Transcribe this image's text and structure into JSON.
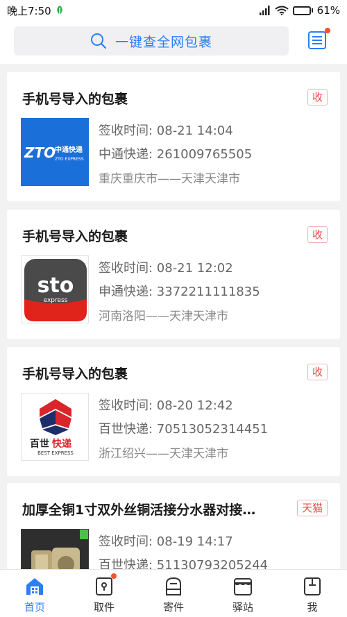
{
  "status_bar": {
    "time": "晚上7:50",
    "battery": "61%",
    "battery_level": 0.61
  },
  "search": {
    "placeholder": "一键查全网包裹"
  },
  "packages": [
    {
      "title": "手机号导入的包裹",
      "tag": "收",
      "signed": "签收时间: 08-21 14:04",
      "courier": "中通快递: 261009765505",
      "route": "重庆重庆市——天津天津市",
      "logo": {
        "brand": "ZTO",
        "cn": "中通快递",
        "en": "ZTO EXPRESS"
      }
    },
    {
      "title": "手机号导入的包裹",
      "tag": "收",
      "signed": "签收时间: 08-21 12:02",
      "courier": "申通快递: 3372211111835",
      "route": "河南洛阳——天津天津市",
      "logo": {
        "brand": "sto",
        "en": "express"
      }
    },
    {
      "title": "手机号导入的包裹",
      "tag": "收",
      "signed": "签收时间: 08-20 12:42",
      "courier": "百世快递: 70513052314451",
      "route": "浙江绍兴——天津天津市",
      "logo": {
        "cn_a": "百世",
        "cn_b": "快递",
        "en": "BEST EXPRESS"
      }
    },
    {
      "title": "加厚全铜1寸双外丝铜活接分水器对接…",
      "tag": "天猫",
      "signed": "签收时间: 08-19 14:17",
      "courier": "百世快递: 51130793205244",
      "route": ""
    }
  ],
  "tabs": [
    {
      "label": "首页",
      "icon": "home-icon",
      "active": true
    },
    {
      "label": "取件",
      "icon": "pickup-icon",
      "badge": true
    },
    {
      "label": "寄件",
      "icon": "send-icon"
    },
    {
      "label": "驿站",
      "icon": "station-icon"
    },
    {
      "label": "我",
      "icon": "profile-icon"
    }
  ],
  "colors": {
    "accent": "#2a7ff6",
    "tag_red": "#e84b4b",
    "zto_blue": "#1b6fd8",
    "sto_dark": "#444444",
    "best_red": "#d9252b"
  }
}
